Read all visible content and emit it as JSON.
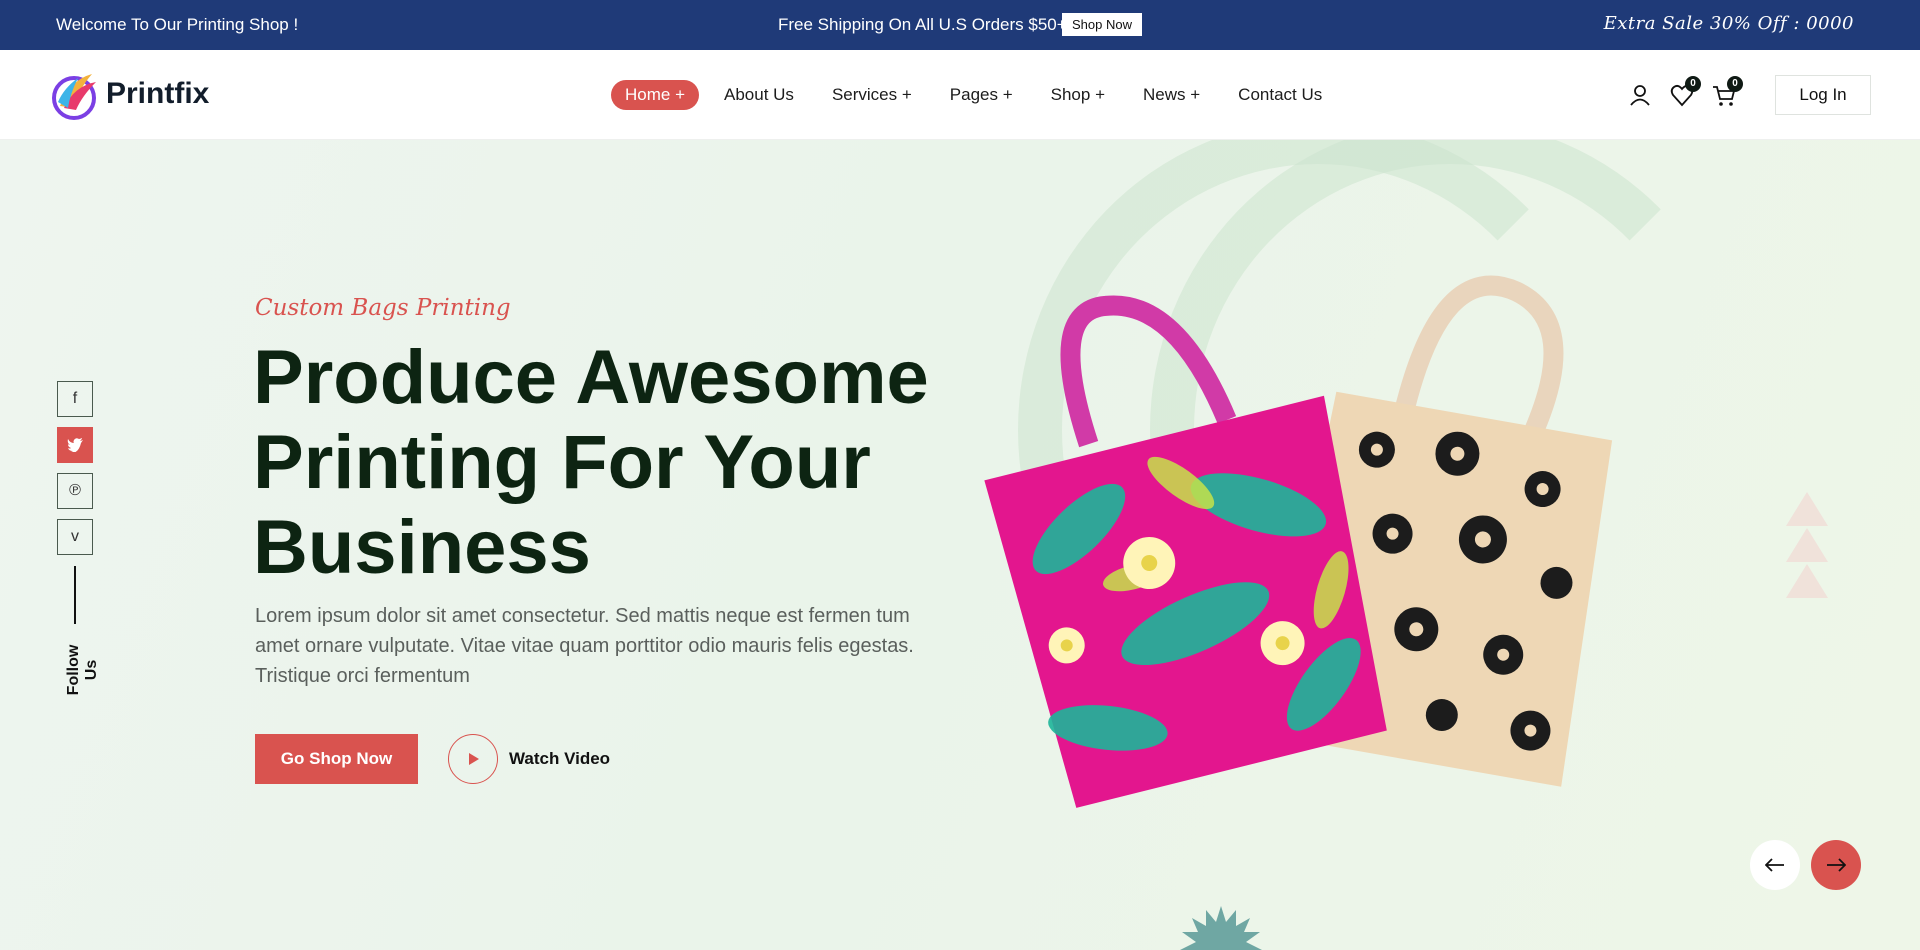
{
  "topbar": {
    "welcome": "Welcome To Our Printing Shop !",
    "shipping": "Free Shipping On All U.S Orders $50+",
    "shop_now": "Shop Now",
    "sale": "Extra Sale 30% Off : 0000"
  },
  "header": {
    "brand": "Printfix",
    "nav": [
      {
        "label": "Home +",
        "active": true
      },
      {
        "label": "About Us"
      },
      {
        "label": "Services +"
      },
      {
        "label": "Pages +"
      },
      {
        "label": "Shop +"
      },
      {
        "label": "News +"
      },
      {
        "label": "Contact Us"
      }
    ],
    "wishlist_count": "0",
    "cart_count": "0",
    "login": "Log In"
  },
  "hero": {
    "kicker": "Custom Bags Printing",
    "headline": "Produce Awesome Printing For Your Business",
    "lede": "Lorem ipsum dolor sit amet consectetur. Sed mattis neque est fermen tum amet ornare vulputate. Vitae vitae quam porttitor odio mauris felis egestas. Tristique orci fermentum",
    "cta": "Go Shop Now",
    "watch": "Watch Video"
  },
  "social": {
    "icons": [
      "facebook-icon",
      "twitter-icon",
      "pinterest-icon",
      "vimeo-icon"
    ],
    "follow": "Follow Us"
  },
  "colors": {
    "accent": "#d9534f",
    "topbar": "#1f3a78",
    "heading": "#0d2412"
  }
}
